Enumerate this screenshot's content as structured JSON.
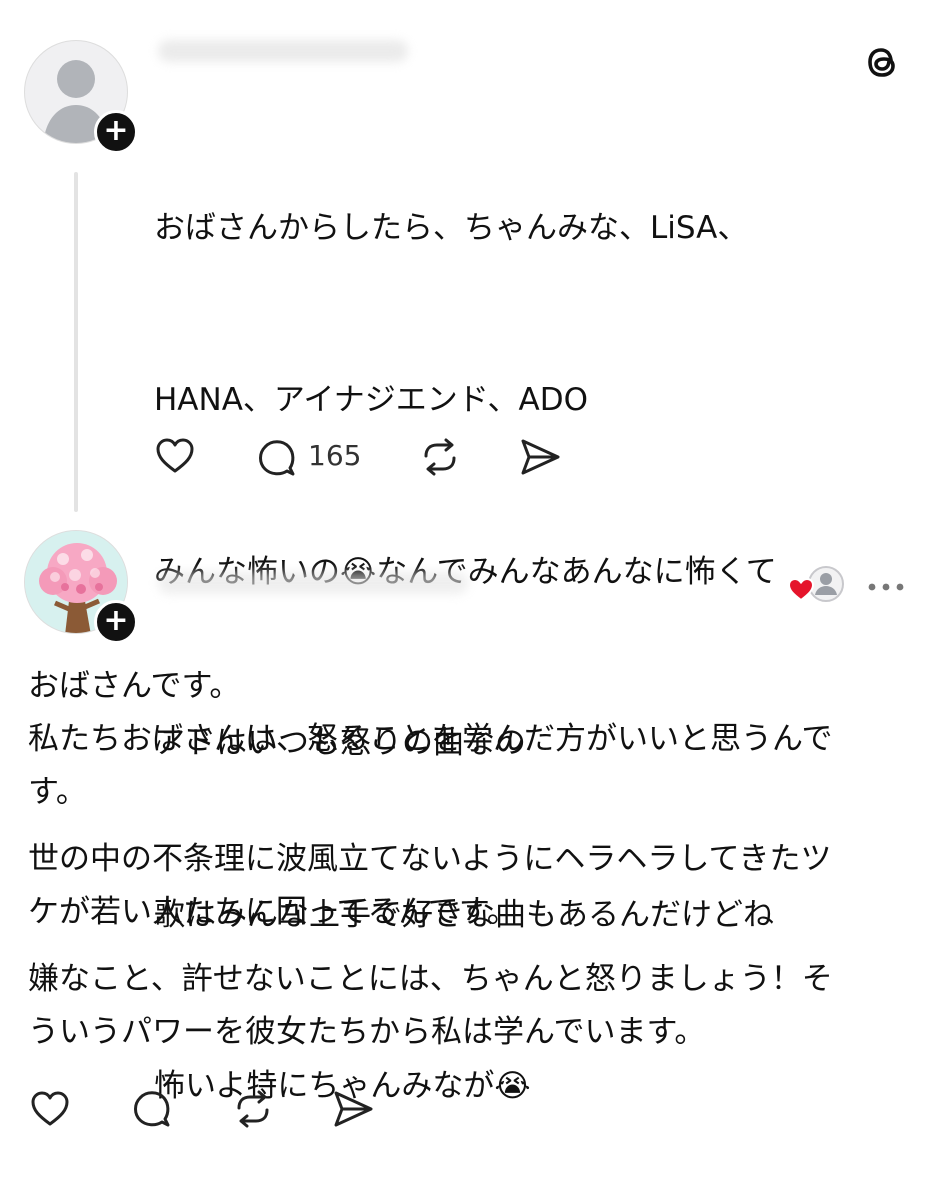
{
  "app": {
    "logo_icon": "threads-logo-icon"
  },
  "post1": {
    "lines": [
      "おばさんからしたら、ちゃんみな、LiSA、",
      "HANA、アイナジエンド、ADO",
      "みんな怖いの😭なんでみんなあんなに怖くて",
      "アドはいつも怒りの曲なの",
      "歌はみんな上手で好きな曲もあるんだけどね",
      "怖いよ特にちゃんみなが😭"
    ],
    "reply_count": "165"
  },
  "post2": {
    "paragraphs": [
      "おばさんです。\n私たちおばさんは、怒ることを学んだ方がいいと思うんで\nす。",
      "世の中の不条理に波風立てないようにヘラヘラしてきたツ\nケが若い人たちに回ってるんです。",
      "嫌なこと、許せないことには、ちゃんと怒りましょう！そ\nういうパワーを彼女たちから私は学んでいます。"
    ]
  },
  "colors": {
    "text": "#111111",
    "muted": "#333333",
    "like_heart": "#e5142b",
    "badge": "#111111"
  }
}
